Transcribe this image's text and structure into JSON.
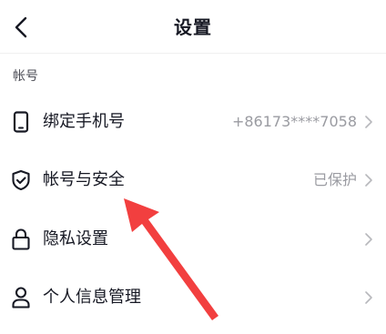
{
  "header": {
    "title": "设置",
    "back_icon": "chevron-left-icon"
  },
  "section": {
    "label": "帐号"
  },
  "rows": [
    {
      "label": "绑定手机号",
      "value": "+86173****7058",
      "icon": "phone-icon"
    },
    {
      "label": "帐号与安全",
      "value": "已保护",
      "icon": "shield-check-icon"
    },
    {
      "label": "隐私设置",
      "value": "",
      "icon": "lock-icon"
    },
    {
      "label": "个人信息管理",
      "value": "",
      "icon": "person-icon"
    }
  ],
  "annotation": {
    "color": "#f23f3f",
    "icon": "red-pointer-arrow"
  }
}
